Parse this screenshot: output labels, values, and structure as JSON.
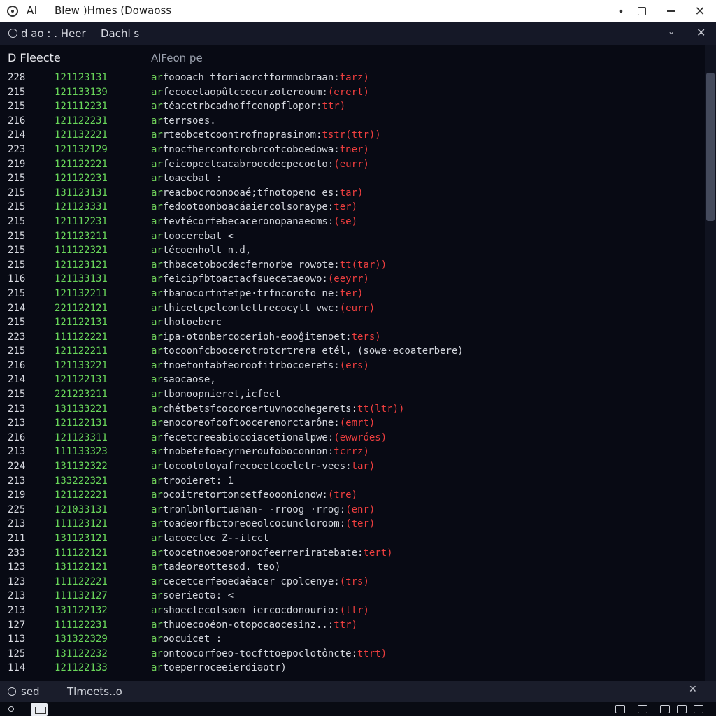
{
  "titlebar": {
    "app_name": "Al",
    "title": "Blew )Hmes (Dowaoss",
    "dot_glyph": "•",
    "close_glyph": "✕"
  },
  "toolbar": {
    "left_text": "d ao :  . Heer",
    "tab_label": "Dachl s",
    "chevron_glyph": "⌄",
    "close_glyph": "✕"
  },
  "panel": {
    "header_left": "D Fleecte",
    "header_mid": "AlFeon pe"
  },
  "rows": [
    {
      "line": "228",
      "hash": "121123131",
      "marker": "ar",
      "body": "foooach tforiaorctformnobraan:",
      "tag": "tarz)"
    },
    {
      "line": "215",
      "hash": "121133139",
      "marker": "ar",
      "body": "fecocetaopûtccocurzoterooum:",
      "tag": "(erert)"
    },
    {
      "line": "215",
      "hash": "121112231",
      "marker": "ar",
      "body": "téacetrbcadnoffconopflopor:",
      "tag": "ttr)"
    },
    {
      "line": "216",
      "hash": "121122231",
      "marker": "ar",
      "body": "terrsoes.",
      "tag": ""
    },
    {
      "line": "214",
      "hash": "121132221",
      "marker": "ar",
      "body": "rteobcetcoontrofnoprasinom:",
      "tag": "tstr(ttr))"
    },
    {
      "line": "223",
      "hash": "121132129",
      "marker": "ar",
      "body": "tnocfhercontorobrcotcoboedowa:",
      "tag": "tner)"
    },
    {
      "line": "219",
      "hash": "121122221",
      "marker": "ar",
      "body": "feicopectcacabroocdecpecooto:",
      "tag": "(eurr)"
    },
    {
      "line": "215",
      "hash": "121122231",
      "marker": "ar",
      "body": "toaecbat   :",
      "tag": ""
    },
    {
      "line": "215",
      "hash": "131123131",
      "marker": "ar",
      "body": "reacbocroonooaé;tfnotopeno es:",
      "tag": "tar)"
    },
    {
      "line": "215",
      "hash": "121123331",
      "marker": "ar",
      "body": "fedootoonboacáaiercolsoraype:",
      "tag": "ter)"
    },
    {
      "line": "215",
      "hash": "121112231",
      "marker": "ar",
      "body": "tevtécorfebecaceronopanaeoms:",
      "tag": "(se)"
    },
    {
      "line": "215",
      "hash": "121123211",
      "marker": "ar",
      "body": "toocerebat  <",
      "tag": ""
    },
    {
      "line": "215",
      "hash": "111122321",
      "marker": "ar",
      "body": "técoenholt  n.d,",
      "tag": ""
    },
    {
      "line": "215",
      "hash": "121123121",
      "marker": "ar",
      "body": "thbacetobocdecfernorbe rowote:",
      "tag": "tt(tar))"
    },
    {
      "line": "116",
      "hash": "121133131",
      "marker": "ar",
      "body": "feicipfbtoactacfsuecetaeowo:",
      "tag": "(eeyrr)"
    },
    {
      "line": "215",
      "hash": "121132211",
      "marker": "ar",
      "body": "tbanocortntetpe·trfncoroto ne:",
      "tag": "ter)"
    },
    {
      "line": "214",
      "hash": "221122121",
      "marker": "ar",
      "body": "thicetcpelcontettrecocytt vwc:",
      "tag": "(eurr)"
    },
    {
      "line": "215",
      "hash": "121122131",
      "marker": "ar",
      "body": "thotoeberc",
      "tag": ""
    },
    {
      "line": "223",
      "hash": "111122221",
      "marker": "ar",
      "body": "ipa·otonbercocerioh-eooĝitenoet:",
      "tag": "ters)"
    },
    {
      "line": "215",
      "hash": "121122211",
      "marker": "ar",
      "body": "tocoonfcboocerotrotcrtrera etél,     (sowe·ecoaterbere)",
      "tag": ""
    },
    {
      "line": "216",
      "hash": "121133221",
      "marker": "ar",
      "body": "tnoetontabfeoroofitrbocoerets:",
      "tag": "(ers)"
    },
    {
      "line": "214",
      "hash": "121122131",
      "marker": "ar",
      "body": "saocaose,",
      "tag": ""
    },
    {
      "line": "215",
      "hash": "221223211",
      "marker": "ar",
      "body": "tbonoopnieret,icfect",
      "tag": ""
    },
    {
      "line": "213",
      "hash": "131133221",
      "marker": "ar",
      "body": "chétbetsfcocoroertuvnocohegerets:",
      "tag": "tt(ltr))"
    },
    {
      "line": "213",
      "hash": "121122131",
      "marker": "ar",
      "body": "enocoreofcoftoocerenorctarône:",
      "tag": "(emrt)"
    },
    {
      "line": "216",
      "hash": "121123311",
      "marker": "ar",
      "body": "fecetcreeabiocoiacetionalpwe:",
      "tag": "(ewwróes)"
    },
    {
      "line": "213",
      "hash": "111133323",
      "marker": "ar",
      "body": "tnobetefoecyrneroufoboconnon:",
      "tag": "tcrrz)"
    },
    {
      "line": "224",
      "hash": "131132322",
      "marker": "ar",
      "body": "tocoototoyafrecoeetcoeletr-vees:",
      "tag": "tar)"
    },
    {
      "line": "213",
      "hash": "133222321",
      "marker": "ar",
      "body": "trooieret:   1",
      "tag": ""
    },
    {
      "line": "219",
      "hash": "121122221",
      "marker": "ar",
      "body": "ocoitretortoncetfeooonionow:",
      "tag": "(tre)"
    },
    {
      "line": "225",
      "hash": "121033131",
      "marker": "ar",
      "body": "tronlbnlortuanan-  -rroog ·rrog:",
      "tag": "(enr)"
    },
    {
      "line": "213",
      "hash": "111123121",
      "marker": "ar",
      "body": "toadeorfbctoreoeolcocuncloroom:",
      "tag": "(ter)"
    },
    {
      "line": "211",
      "hash": "131123121",
      "marker": "ar",
      "body": "tacoectec Z--ilcct",
      "tag": ""
    },
    {
      "line": "233",
      "hash": "111122121",
      "marker": "ar",
      "body": "toocetnoeooeronocfeerreriratebate:",
      "tag": "tert)"
    },
    {
      "line": "123",
      "hash": "131122121",
      "marker": "ar",
      "body": "tadeoreottesod. teo)",
      "tag": ""
    },
    {
      "line": "123",
      "hash": "111122221",
      "marker": "ar",
      "body": "cecetcerfeoedaêacer cpolcenye:",
      "tag": "(trs)"
    },
    {
      "line": "213",
      "hash": "111132127",
      "marker": "ar",
      "body": "soerieotə:   <",
      "tag": ""
    },
    {
      "line": "213",
      "hash": "131122132",
      "marker": "ar",
      "body": "shoectecotsoon iercocdonourio:",
      "tag": "(ttr)"
    },
    {
      "line": "127",
      "hash": "111122231",
      "marker": "ar",
      "body": "thuoecooéon-otopocaocesinz..:",
      "tag": "ttr)"
    },
    {
      "line": "113",
      "hash": "131322329",
      "marker": "ar",
      "body": "oocuicet :",
      "tag": ""
    },
    {
      "line": "125",
      "hash": "131122232",
      "marker": "ar",
      "body": "ontoocorfoeo-tocfttoepoclotôncte:",
      "tag": "ttrt)"
    },
    {
      "line": "114",
      "hash": "121122133",
      "marker": "ar",
      "body": "toeperroceeierdiəotr)",
      "tag": ""
    }
  ],
  "statusbar": {
    "status": "sed",
    "label": "Tlmeets..o",
    "close_glyph": "✕"
  },
  "colors": {
    "hash_green": "#69d65a",
    "tag_red": "#ef3f3f",
    "background": "#080a14"
  }
}
